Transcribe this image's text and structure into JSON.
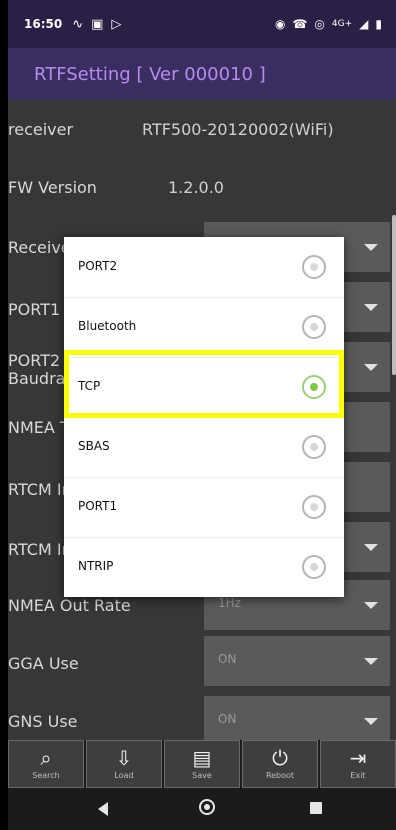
{
  "status_bar": {
    "time": "16:50",
    "icons_left": [
      "wave-icon",
      "photo-icon",
      "play-icon"
    ],
    "icons_right": [
      "vibrate-icon",
      "call-wifi-icon",
      "hotspot-icon",
      "4g-icon",
      "signal-icon",
      "battery-icon"
    ],
    "net_label": "4G+"
  },
  "app_bar": {
    "title": "RTFSetting [ Ver 000010 ]"
  },
  "settings": {
    "receiver": {
      "label": "receiver",
      "value": "RTF500-20120002(WiFi)"
    },
    "fw": {
      "label": "FW Version",
      "value": "1.2.0.0"
    },
    "receive_label": "Receive",
    "port1_label": "PORT1",
    "port2_label": "PORT2",
    "baud_label": "Baudra",
    "nmea_label": "NMEA T",
    "rtcm1_label": "RTCM In",
    "rtcm2_label": "RTCM In",
    "nmea_rate": {
      "label": "NMEA Out Rate",
      "value": "1Hz"
    },
    "gga": {
      "label": "GGA Use",
      "value": "ON"
    },
    "gns": {
      "label": "GNS Use",
      "value": "ON"
    }
  },
  "dialog": {
    "options": [
      {
        "label": "PORT2",
        "selected": false
      },
      {
        "label": "Bluetooth",
        "selected": false
      },
      {
        "label": "TCP",
        "selected": true
      },
      {
        "label": "SBAS",
        "selected": false
      },
      {
        "label": "PORT1",
        "selected": false
      },
      {
        "label": "NTRIP",
        "selected": false
      }
    ],
    "highlight_color": "#fbff00",
    "selected_color": "#7ac943"
  },
  "toolbar": {
    "search": {
      "label": "Search",
      "icon": "search-icon"
    },
    "load": {
      "label": "Load",
      "icon": "load-icon"
    },
    "save": {
      "label": "Save",
      "icon": "save-icon"
    },
    "reboot": {
      "label": "Reboot",
      "icon": "power-icon"
    },
    "exit": {
      "label": "Exit",
      "icon": "exit-icon"
    }
  },
  "nav": {
    "back": "back-icon",
    "home": "home-icon",
    "recents": "recents-icon"
  },
  "colors": {
    "status_bar": "#2b1f46",
    "app_bar": "#3a2d5f",
    "title": "#b58bf0",
    "content_bg": "#373737"
  }
}
